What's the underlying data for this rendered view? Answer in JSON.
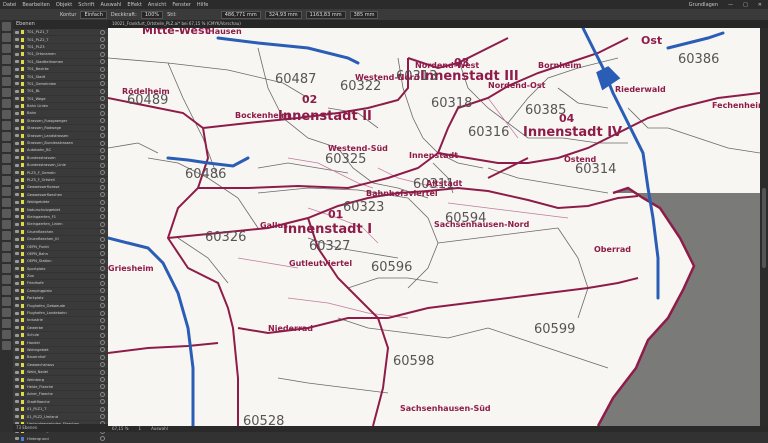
{
  "app": {
    "menu": [
      "Datei",
      "Bearbeiten",
      "Objekt",
      "Schrift",
      "Auswahl",
      "Effekt",
      "Ansicht",
      "Fenster",
      "Hilfe"
    ],
    "workspace": "Grundlagen"
  },
  "control_bar": {
    "label_fill": "Kontur",
    "stroke_field": "Einfach",
    "opacity_label": "Deckkraft:",
    "opacity_value": "100%",
    "style_label": "Stil:",
    "x_field": "486,771 mm",
    "y_field": "324,93 mm",
    "w_field": "1163,83 mm",
    "h_field": "385 mm"
  },
  "document_tab": {
    "title": "10021_Frankfurt_Ortsteile_PLZ.ai* bei 67,15 % (CMYK/Vorschau)"
  },
  "layers_panel": {
    "title": "Ebenen",
    "rows": [
      {
        "name": "T01_PLZ1_T",
        "color": "#e0d94a"
      },
      {
        "name": "T01_PLZ2_T",
        "color": "#e0d94a"
      },
      {
        "name": "T01_PLZ3",
        "color": "#e0d94a"
      },
      {
        "name": "T01_Ortsnamen",
        "color": "#e0d94a"
      },
      {
        "name": "T01_Stadtteilnamen",
        "color": "#e0d94a"
      },
      {
        "name": "T01_Bezirke",
        "color": "#e0d94a"
      },
      {
        "name": "T01_Stadt",
        "color": "#e0d94a"
      },
      {
        "name": "T01_Gemeinden",
        "color": "#e0d94a"
      },
      {
        "name": "T01_BL",
        "color": "#e0d94a"
      },
      {
        "name": "T01_Wege",
        "color": "#e0d94a"
      },
      {
        "name": "Bahn Linien",
        "color": "#e0d94a"
      },
      {
        "name": "Bahn",
        "color": "#e0d94a"
      },
      {
        "name": "Strassen_Fussgaenger",
        "color": "#e0d94a"
      },
      {
        "name": "Strassen_Radwege",
        "color": "#e0d94a"
      },
      {
        "name": "Strassen_Landstrassen",
        "color": "#e0d94a"
      },
      {
        "name": "Strassen_Bundesstrassen",
        "color": "#e0d94a"
      },
      {
        "name": "Autobahn_BC",
        "color": "#e0d94a"
      },
      {
        "name": "Bundesstrassen",
        "color": "#e0d94a"
      },
      {
        "name": "Bundesstrassen_Linie",
        "color": "#e0d94a"
      },
      {
        "name": "PLZ5_F_Gemein",
        "color": "#e0d94a"
      },
      {
        "name": "PLZ5_F_Ortsteil",
        "color": "#e0d94a"
      },
      {
        "name": "Gewaesserfluesse",
        "color": "#e0d94a"
      },
      {
        "name": "Gewaesserflaechen",
        "color": "#e0d94a"
      },
      {
        "name": "Waldgebiete",
        "color": "#e0d94a"
      },
      {
        "name": "Naturschutzgebiet",
        "color": "#e0d94a"
      },
      {
        "name": "Kleingaerten_F1",
        "color": "#e0d94a"
      },
      {
        "name": "Kleingaerten_Linien",
        "color": "#e0d94a"
      },
      {
        "name": "Gruenflaechen",
        "color": "#e0d94a"
      },
      {
        "name": "Gruenflaechen_Kl",
        "color": "#e0d94a"
      },
      {
        "name": "OEPN_Punkt",
        "color": "#e0d94a"
      },
      {
        "name": "OEPN_Bahn",
        "color": "#e0d94a"
      },
      {
        "name": "OEPN_Station",
        "color": "#e0d94a"
      },
      {
        "name": "Sportplatz",
        "color": "#e0d94a"
      },
      {
        "name": "Zoo",
        "color": "#e0d94a"
      },
      {
        "name": "Friedhofe",
        "color": "#e0d94a"
      },
      {
        "name": "Campingplatz",
        "color": "#e0d94a"
      },
      {
        "name": "Parkplatz",
        "color": "#e0d94a"
      },
      {
        "name": "Flughafen_Gebaeude",
        "color": "#e0d94a"
      },
      {
        "name": "Flughafen_Landebahn",
        "color": "#e0d94a"
      },
      {
        "name": "Industrie",
        "color": "#e0d94a"
      },
      {
        "name": "Gewerbe",
        "color": "#e0d94a"
      },
      {
        "name": "Schule",
        "color": "#e0d94a"
      },
      {
        "name": "Handel",
        "color": "#e0d94a"
      },
      {
        "name": "Wohngebiet",
        "color": "#e0d94a"
      },
      {
        "name": "Bauernhof",
        "color": "#e0d94a"
      },
      {
        "name": "Gewaechshaus",
        "color": "#e0d94a"
      },
      {
        "name": "Wald_Nadel",
        "color": "#e0d94a"
      },
      {
        "name": "Weinberg",
        "color": "#e0d94a"
      },
      {
        "name": "Heide_Flaeche",
        "color": "#e0d94a"
      },
      {
        "name": "Acker_Flaeche",
        "color": "#e0d94a"
      },
      {
        "name": "Stadtflaeche",
        "color": "#e0d94a"
      },
      {
        "name": "01_PLZ1_T",
        "color": "#e0d94a"
      },
      {
        "name": "01_PLZ2_Umland",
        "color": "#e0d94a"
      },
      {
        "name": "Umlandgemeinden_Flaechen",
        "color": "#e0d94a"
      },
      {
        "name": "Landkreise_Flaeche",
        "color": "#e0d94a"
      },
      {
        "name": "Hintergrund",
        "color": "#4a7fd8"
      }
    ],
    "footer": "73 Ebenen"
  },
  "status_bar": {
    "zoom": "67,15 %",
    "page": "1",
    "tool": "Auswahl"
  },
  "map": {
    "districts": [
      {
        "num": "01",
        "name": "Innenstadt I"
      },
      {
        "num": "02",
        "name": "Innenstadt II"
      },
      {
        "num": "03",
        "name": "Innenstadt III"
      },
      {
        "num": "04",
        "name": "Innenstadt IV"
      }
    ],
    "plz_labels": [
      "60487",
      "60489",
      "60486",
      "60326",
      "60327",
      "60325",
      "60318",
      "60316",
      "60385",
      "60386",
      "60314",
      "60594",
      "60596",
      "60598",
      "60599",
      "60528",
      "60323",
      "60313",
      "60311",
      "60322"
    ],
    "place_labels": [
      "Rödelheim",
      "Bockenheim",
      "Westend-Nord",
      "Westend-Süd",
      "Nordend-West",
      "Nordend-Ost",
      "Bornheim",
      "Riederwald",
      "Fechenheim",
      "Ostend",
      "Innenstadt",
      "Altstadt",
      "Bahnhofsviertel",
      "Gallus",
      "Gutleutviertel",
      "Sachsenhausen-Nord",
      "Oberrad",
      "Niederrad",
      "Griesheim",
      "Sachsenhausen-Süd",
      "Mitte-West",
      "Hausen",
      "Ost"
    ],
    "colors": {
      "background": "#f8f6f2",
      "district_border": "#8e1c4a",
      "plz_border": "#5a5a5a",
      "river": "#2a5db5",
      "outside_area": "#7a7a78",
      "district_label": "#8e1c4a",
      "plz_label": "#4a4a4a"
    }
  }
}
